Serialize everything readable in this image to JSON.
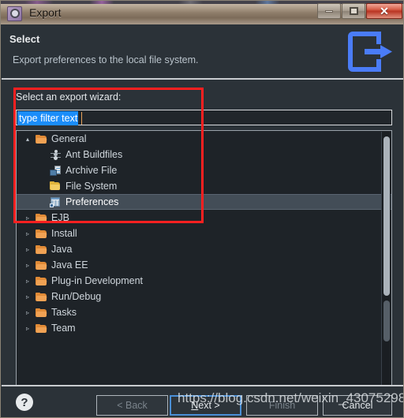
{
  "window": {
    "title": "Export",
    "icon": "gear-icon",
    "controls": {
      "minimize": "–",
      "maximize": "□",
      "close": "✕"
    }
  },
  "header": {
    "title": "Select",
    "subtitle": "Export preferences to the local file system.",
    "icon": "export-arrow-icon"
  },
  "main": {
    "wizard_label": "Select an export wizard:",
    "filter": {
      "value": "type filter text",
      "placeholder": "type filter text",
      "selected": true
    },
    "tree": [
      {
        "label": "General",
        "icon": "folder-open-icon",
        "level": 0,
        "expanded": true,
        "twisty": "▴",
        "selected": false
      },
      {
        "label": "Ant Buildfiles",
        "icon": "ant-icon",
        "level": 1,
        "expanded": false,
        "twisty": "",
        "selected": false
      },
      {
        "label": "Archive File",
        "icon": "archive-file-icon",
        "level": 1,
        "expanded": false,
        "twisty": "",
        "selected": false
      },
      {
        "label": "File System",
        "icon": "file-system-icon",
        "level": 1,
        "expanded": false,
        "twisty": "",
        "selected": false
      },
      {
        "label": "Preferences",
        "icon": "preferences-icon",
        "level": 1,
        "expanded": false,
        "twisty": "",
        "selected": true
      },
      {
        "label": "EJB",
        "icon": "folder-icon",
        "level": 0,
        "expanded": false,
        "twisty": "▹",
        "selected": false
      },
      {
        "label": "Install",
        "icon": "folder-icon",
        "level": 0,
        "expanded": false,
        "twisty": "▹",
        "selected": false
      },
      {
        "label": "Java",
        "icon": "folder-icon",
        "level": 0,
        "expanded": false,
        "twisty": "▹",
        "selected": false
      },
      {
        "label": "Java EE",
        "icon": "folder-icon",
        "level": 0,
        "expanded": false,
        "twisty": "▹",
        "selected": false
      },
      {
        "label": "Plug-in Development",
        "icon": "folder-icon",
        "level": 0,
        "expanded": false,
        "twisty": "▹",
        "selected": false
      },
      {
        "label": "Run/Debug",
        "icon": "folder-icon",
        "level": 0,
        "expanded": false,
        "twisty": "▹",
        "selected": false
      },
      {
        "label": "Tasks",
        "icon": "folder-icon",
        "level": 0,
        "expanded": false,
        "twisty": "▹",
        "selected": false
      },
      {
        "label": "Team",
        "icon": "folder-icon",
        "level": 0,
        "expanded": false,
        "twisty": "▹",
        "selected": false
      }
    ]
  },
  "footer": {
    "help": "?",
    "back": "< Back",
    "next_mnemonic": "N",
    "next_rest": "ext >",
    "finish": "Finish",
    "cancel": "Cancel"
  },
  "overlay": {
    "watermark": "https://blog.csdn.net/weixin_43075298",
    "annotation_color": "#ff2020"
  },
  "colors": {
    "dialog_bg": "#2b3238",
    "tree_bg": "#1e2328",
    "selection_bg": "#434d57",
    "filter_selection": "#1b8dfa",
    "accent_icon": "#4a7cf7",
    "folder": "#e08a36"
  }
}
